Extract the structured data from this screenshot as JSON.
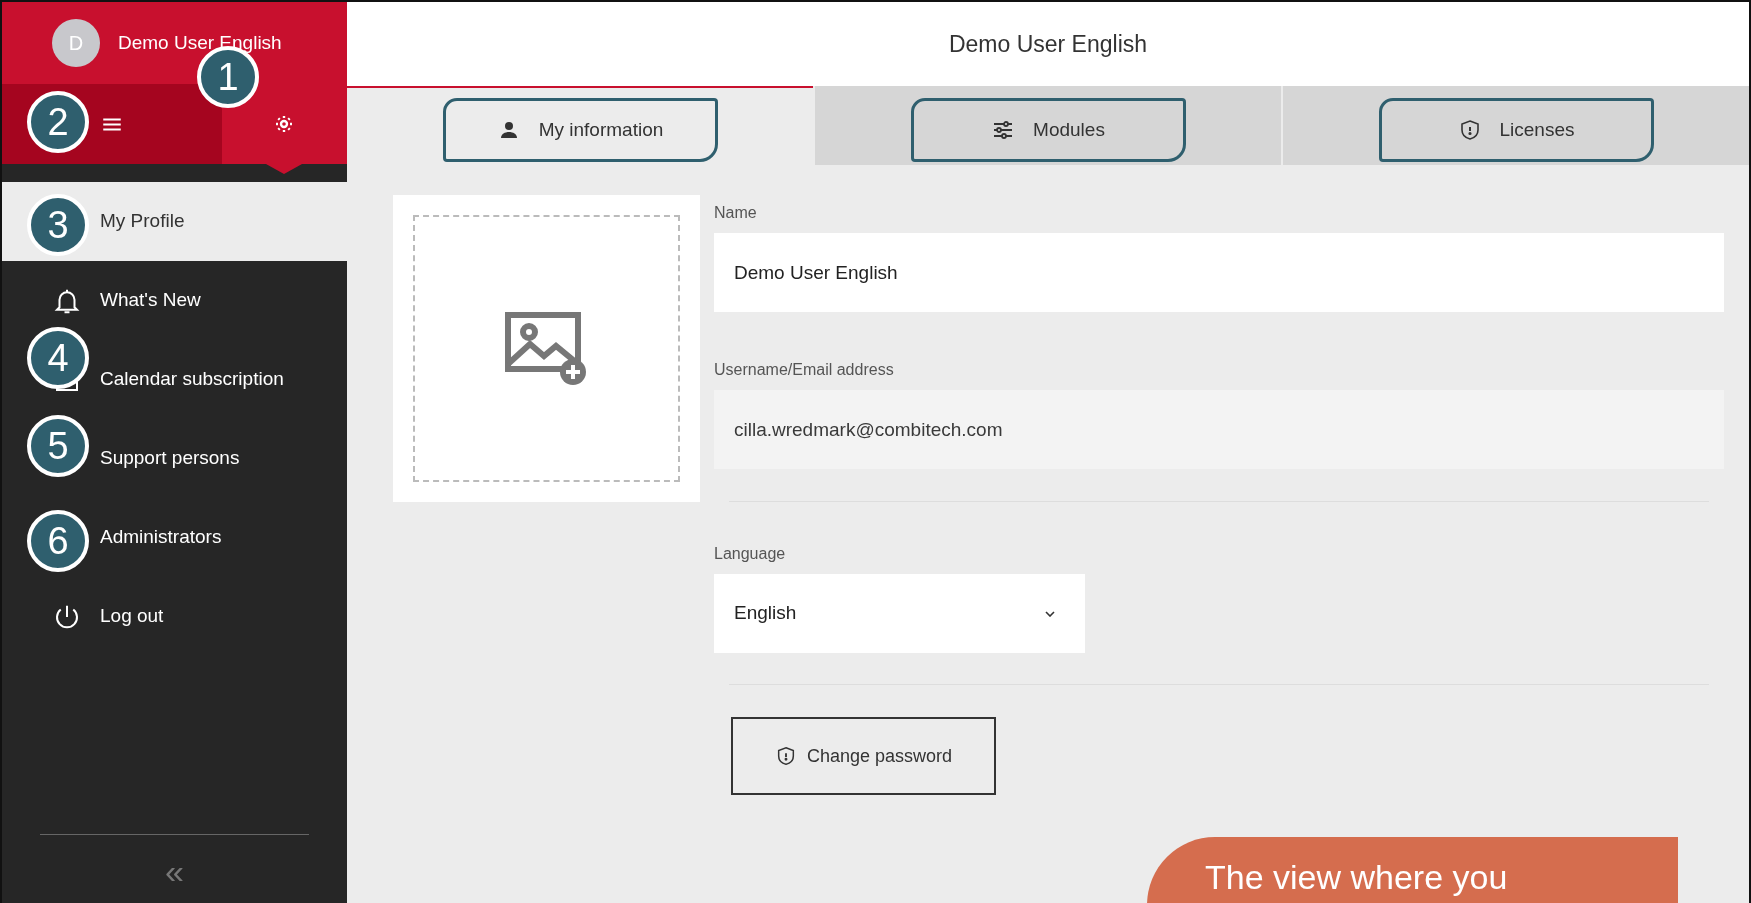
{
  "user": {
    "initial": "D",
    "name": "Demo User English"
  },
  "top_buttons": [
    {
      "kind": "menu",
      "selected": false
    },
    {
      "kind": "settings",
      "selected": true
    }
  ],
  "sidebar": {
    "items": [
      {
        "label": "My Profile",
        "selected": true
      },
      {
        "label": "What's New",
        "selected": false
      },
      {
        "label": "Calendar subscription",
        "selected": false
      },
      {
        "label": "Support persons",
        "selected": false
      },
      {
        "label": "Administrators",
        "selected": false
      },
      {
        "label": "Log out",
        "selected": false
      }
    ],
    "collapse": "«"
  },
  "header": {
    "title": "Demo User English"
  },
  "tabs": [
    {
      "label": "My information",
      "selected": true
    },
    {
      "label": "Modules",
      "selected": false
    },
    {
      "label": "Licenses",
      "selected": false
    }
  ],
  "form": {
    "fields": [
      {
        "label": "Name",
        "value": "Demo User English",
        "disabled": false
      },
      {
        "label": "Username/Email address",
        "value": "cilla.wredmark@combitech.com",
        "disabled": true
      }
    ],
    "language": {
      "label": "Language",
      "value": "English"
    },
    "change_password": "Change password"
  },
  "annotations": [
    "1",
    "2",
    "3",
    "4",
    "5",
    "6"
  ],
  "callout": {
    "text": "The view where you"
  }
}
